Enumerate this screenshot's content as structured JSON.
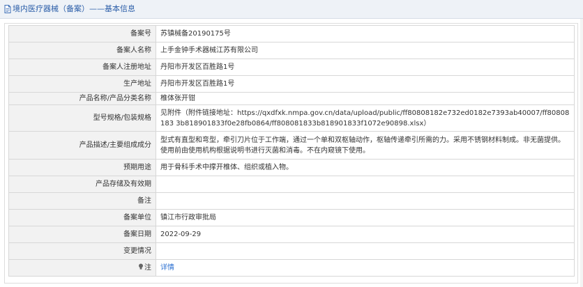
{
  "header": {
    "title": "境内医疗器械（备案）——基本信息",
    "icon": "document-icon"
  },
  "rows": [
    {
      "label": "备案号",
      "value": "苏镇械备20190175号"
    },
    {
      "label": "备案人名称",
      "value": "上手金钟手术器械江苏有限公司"
    },
    {
      "label": "备案人注册地址",
      "value": "丹阳市开发区百胜路1号"
    },
    {
      "label": "生产地址",
      "value": "丹阳市开发区百胜路1号"
    },
    {
      "label": "产品名称/产品分类名称",
      "value": "椎体张开钳"
    },
    {
      "label": "型号规格/包装规格",
      "value": "见附件（附件链接地址：https://qxdfxk.nmpa.gov.cn/data/upload/public/ff80808182e732ed0182e7393ab40007/ff80808183 3b818901833f0e28fb0864/ff808081833b818901833f1072e90898.xlsx）"
    },
    {
      "label": "产品描述/主要组成成分",
      "value": "型式有直型和弯型，牵引刀片位于工作端，通过一个单和双枢轴动作，枢轴传递牵引所需的力。采用不锈钢材料制成。非无菌提供。使用前由使用机构根据说明书进行灭菌和消毒。不在内窥镜下使用。"
    },
    {
      "label": "预期用途",
      "value": "用于骨科手术中撑开椎体、组织或植入物。"
    },
    {
      "label": "产品存储及有效期",
      "value": ""
    },
    {
      "label": "备注",
      "value": ""
    },
    {
      "label": "备案单位",
      "value": "镇江市行政审批局"
    },
    {
      "label": "备案日期",
      "value": "2022-09-29"
    },
    {
      "label": "变更情况",
      "value": ""
    }
  ],
  "note": {
    "label": "注",
    "icon": "lightbulb-icon",
    "link_text": "详情"
  },
  "colors": {
    "header_bg": "#eef2f7",
    "title": "#2a5da8",
    "label_bg": "#f2f2f2",
    "border": "#d7d7d7",
    "link": "#2a6fd1"
  }
}
